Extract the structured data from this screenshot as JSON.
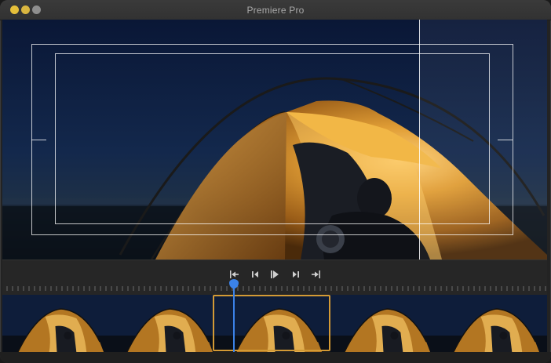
{
  "window": {
    "title": "Premiere Pro",
    "traffic_colors": {
      "close": "#e5bf3a",
      "minimize": "#d9b640",
      "maximize": "#8e8e8e"
    }
  },
  "viewer": {
    "content": "tent-at-night-photo",
    "colors": {
      "sky_top": "#0b1a3c",
      "sky_horizon": "#1e3350",
      "tent": "#c98a2a",
      "glow": "#f4c05a"
    }
  },
  "transport": {
    "buttons": [
      {
        "id": "go-to-in",
        "icon": "go-to-in-point-icon"
      },
      {
        "id": "step-back",
        "icon": "step-back-icon"
      },
      {
        "id": "play",
        "icon": "play-icon"
      },
      {
        "id": "step-forward",
        "icon": "step-forward-icon"
      },
      {
        "id": "go-to-out",
        "icon": "go-to-out-point-icon"
      }
    ]
  },
  "timeline": {
    "playhead_color": "#3b82e8",
    "selection_color": "#d39a35",
    "frame_count": 5,
    "selected_frame": 3
  }
}
